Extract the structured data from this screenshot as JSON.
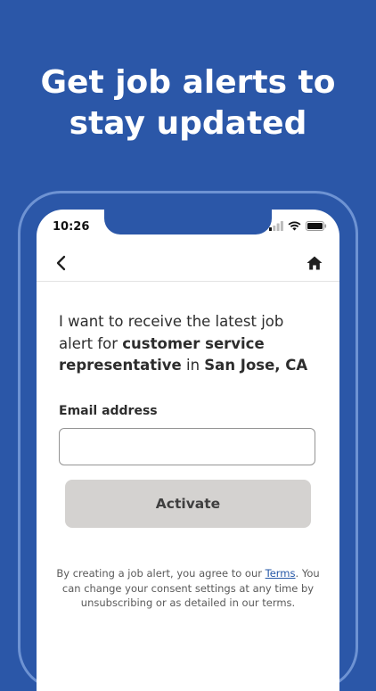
{
  "headline": {
    "line1": "Get job alerts to",
    "line2": "stay updated"
  },
  "status_bar": {
    "time": "10:26"
  },
  "navbar": {
    "back_icon": "chevron-left-icon",
    "home_icon": "home-icon"
  },
  "intro": {
    "prefix": "I want to receive the latest job alert for ",
    "job_title": "customer service representative",
    "connector": " in ",
    "location": "San Jose, CA"
  },
  "email": {
    "label": "Email address",
    "value": "",
    "placeholder": ""
  },
  "activate_button": {
    "label": "Activate"
  },
  "consent": {
    "before_link": "By creating a job alert, you agree to our ",
    "link_text": "Terms",
    "after_link": ". You can change your consent settings at any time by unsubscribing or as detailed in our terms."
  },
  "colors": {
    "background": "#2b57a8",
    "link": "#2557a7",
    "button_bg": "#d4d2d0"
  }
}
